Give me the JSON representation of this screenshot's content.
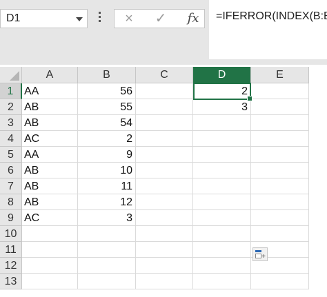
{
  "name_box": {
    "value": "D1"
  },
  "formula_bar": {
    "cancel_icon": "×",
    "enter_icon": "✓",
    "fx_label": "fx",
    "formula": "=IFERROR(INDEX(B:B,A"
  },
  "columns": [
    "A",
    "B",
    "C",
    "D",
    "E"
  ],
  "active_column": "D",
  "active_row": "1",
  "rows": [
    {
      "num": "1",
      "a": "AA",
      "b": "56",
      "d": "2"
    },
    {
      "num": "2",
      "a": "AB",
      "b": "55",
      "d": "3"
    },
    {
      "num": "3",
      "a": "AB",
      "b": "54",
      "d": ""
    },
    {
      "num": "4",
      "a": "AC",
      "b": "2",
      "d": ""
    },
    {
      "num": "5",
      "a": "AA",
      "b": "9",
      "d": ""
    },
    {
      "num": "6",
      "a": "AB",
      "b": "10",
      "d": ""
    },
    {
      "num": "7",
      "a": "AB",
      "b": "11",
      "d": ""
    },
    {
      "num": "8",
      "a": "AB",
      "b": "12",
      "d": ""
    },
    {
      "num": "9",
      "a": "AC",
      "b": "3",
      "d": ""
    },
    {
      "num": "10",
      "a": "",
      "b": "",
      "d": ""
    },
    {
      "num": "11",
      "a": "",
      "b": "",
      "d": ""
    },
    {
      "num": "12",
      "a": "",
      "b": "",
      "d": ""
    },
    {
      "num": "13",
      "a": "",
      "b": "",
      "d": ""
    }
  ],
  "icons": {
    "paste_options": "paste-options-icon"
  },
  "colors": {
    "accent_green": "#217346",
    "header_bg": "#e6e6e6"
  }
}
